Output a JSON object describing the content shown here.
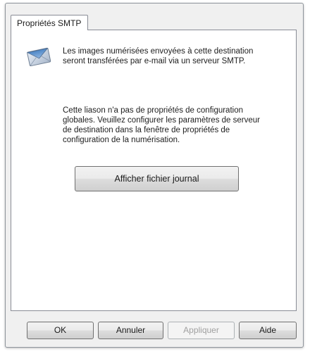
{
  "tabs": [
    {
      "label": "Propriétés SMTP",
      "active": true
    }
  ],
  "info": {
    "icon": "envelope-icon",
    "text_1_line_1": "Les images numérisées envoyées à cette destination",
    "text_1_line_2": "seront transférées par e-mail via un serveur SMTP.",
    "text_2_line_1": "Cette liason n'a pas de propriétés de configuration",
    "text_2_line_2": "globales. Veuillez configurer les paramètres de serveur",
    "text_2_line_3": "de destination dans la fenêtre de propriétés de",
    "text_2_line_4": "configuration de la numérisation."
  },
  "actions": {
    "view_log_label": "Afficher fichier journal"
  },
  "footer": {
    "ok_label": "OK",
    "cancel_label": "Annuler",
    "apply_label": "Appliquer",
    "apply_enabled": false,
    "help_label": "Aide"
  }
}
